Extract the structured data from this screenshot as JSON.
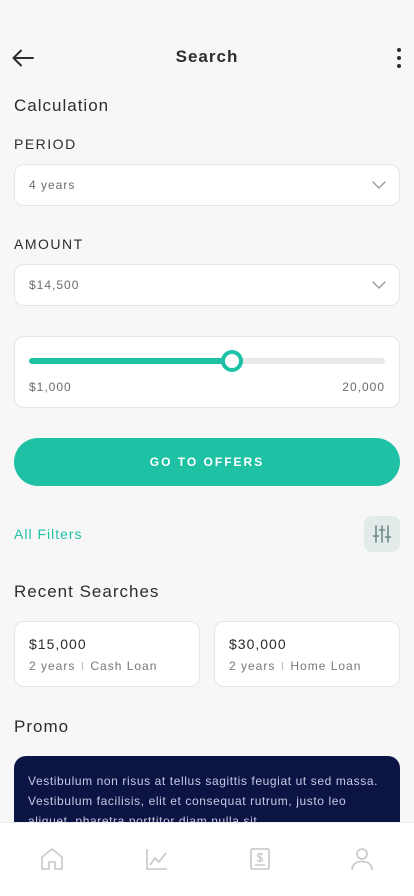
{
  "header": {
    "title": "Search",
    "back_icon": "arrow-left-icon",
    "more_icon": "more-vertical-icon"
  },
  "calculation": {
    "title": "Calculation",
    "period": {
      "label": "PERIOD",
      "value": "4 years"
    },
    "amount": {
      "label": "AMOUNT",
      "value": "$14,500"
    }
  },
  "slider": {
    "min_label": "$1,000",
    "max_label": "20,000",
    "fill_fraction": 0.57
  },
  "cta": {
    "label": "GO TO OFFERS"
  },
  "filters": {
    "label": "All Filters",
    "icon": "sliders-icon"
  },
  "recent": {
    "title": "Recent Searches",
    "items": [
      {
        "amount": "$15,000",
        "period": "2 years",
        "type": "Cash Loan"
      },
      {
        "amount": "$30,000",
        "period": "2 years",
        "type": "Home Loan"
      }
    ]
  },
  "promo": {
    "title": "Promo",
    "text": "Vestibulum non risus at tellus sagittis feugiat ut sed massa. Vestibulum facilisis, elit et consequat rutrum, justo leo aliquet, pharetra porttitor diam nulla sit"
  },
  "tabbar": {
    "icons": [
      "home-icon",
      "chart-icon",
      "receipt-icon",
      "profile-icon"
    ]
  },
  "colors": {
    "accent": "#1fc1a5",
    "promo_bg": "#0c1444",
    "background": "#f7f7f7"
  }
}
